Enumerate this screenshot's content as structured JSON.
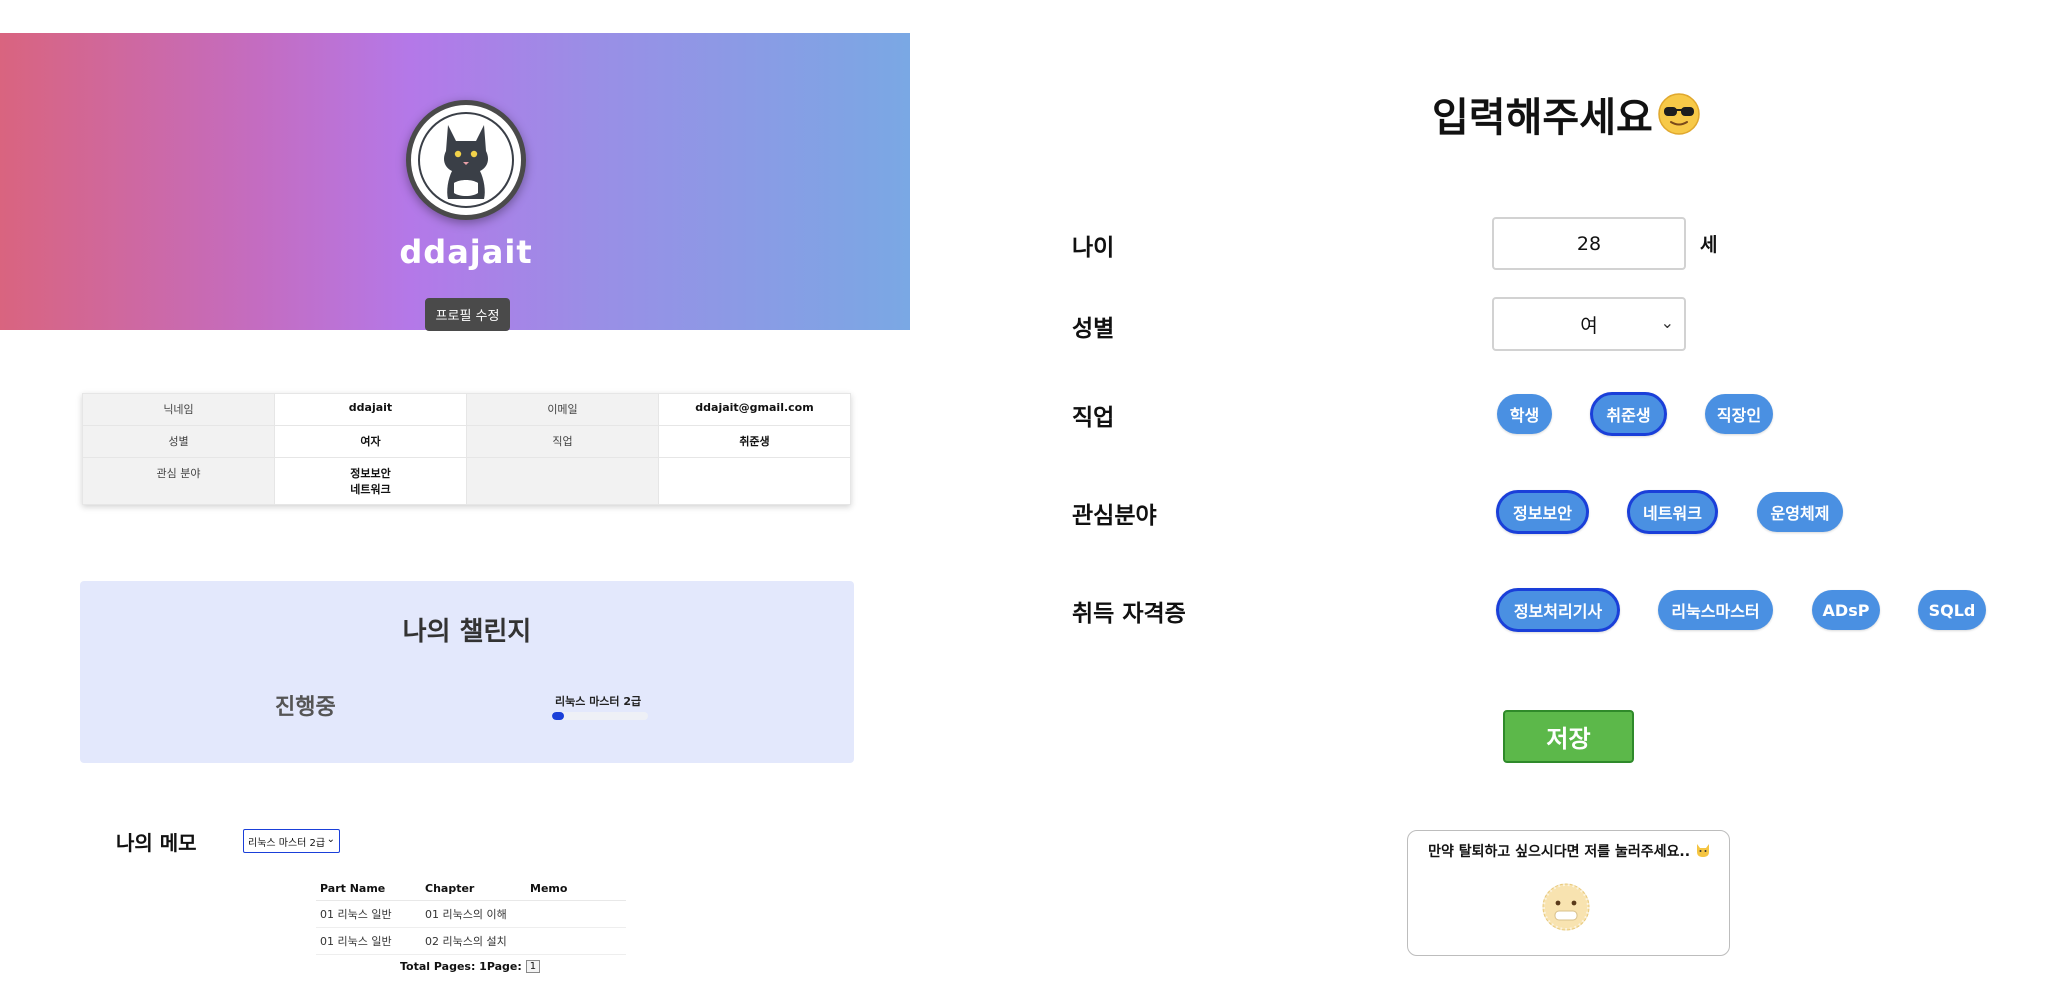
{
  "profile": {
    "nickname": "ddajait",
    "avatar_icon": "cat-icon",
    "edit_button": "프로필 수정",
    "banner_colors": [
      "#d9647f",
      "#b478e8",
      "#7aa8e4"
    ]
  },
  "info_table": {
    "rows": [
      [
        {
          "key": "닉네임",
          "value": "ddajait"
        },
        {
          "key": "이메일",
          "value": "ddajait@gmail.com"
        }
      ],
      [
        {
          "key": "성별",
          "value": "여자"
        },
        {
          "key": "직업",
          "value": "취준생"
        }
      ],
      [
        {
          "key": "관심 분야",
          "value": "정보보안\n네트워크"
        },
        {
          "key": "",
          "value": ""
        }
      ]
    ]
  },
  "challenge": {
    "title": "나의 챌린지",
    "status": "진행중",
    "item_label": "리눅스 마스터 2급",
    "progress": 0.12
  },
  "memo": {
    "title": "나의 메모",
    "selected": "리눅스 마스터 2급",
    "columns": [
      "Part Name",
      "Chapter",
      "Memo"
    ],
    "rows": [
      [
        "01 리눅스 일반",
        "01 리눅스의 이해",
        ""
      ],
      [
        "01 리눅스 일반",
        "02 리눅스의 설치",
        ""
      ]
    ],
    "total_pages_label": "Total Pages: 1",
    "page_label": "Page:",
    "page_button": "1"
  },
  "form": {
    "title": "입력해주세요",
    "title_emoji": "sunglasses-face-icon",
    "age_label": "나이",
    "age_value": "28",
    "age_unit": "세",
    "gender_label": "성별",
    "gender_value": "여",
    "job_label": "직업",
    "jobs": [
      {
        "label": "학생",
        "selected": false
      },
      {
        "label": "취준생",
        "selected": true
      },
      {
        "label": "직장인",
        "selected": false
      }
    ],
    "interest_label": "관심분야",
    "interests": [
      {
        "label": "정보보안",
        "selected": true
      },
      {
        "label": "네트워크",
        "selected": true
      },
      {
        "label": "운영체제",
        "selected": false
      }
    ],
    "cert_label": "취득 자격증",
    "certs": [
      {
        "label": "정보처리기사",
        "selected": true
      },
      {
        "label": "리눅스마스터",
        "selected": false
      },
      {
        "label": "ADsP",
        "selected": false
      },
      {
        "label": "SQLd",
        "selected": false
      }
    ],
    "save_button": "저장",
    "chip_color": "#4a90e2",
    "save_color": "#5cb84a"
  },
  "withdraw": {
    "text": "만약 탈퇴하고 싶으시다면 저를 눌러주세요..",
    "text_emoji": "cat-face-icon",
    "button_icon": "face-with-mouth-icon"
  }
}
